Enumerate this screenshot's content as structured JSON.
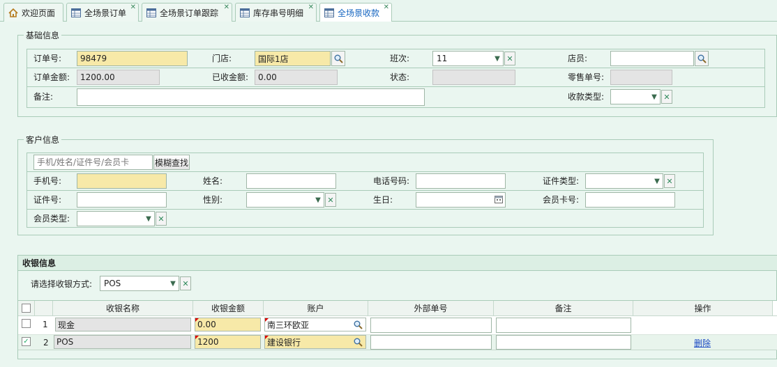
{
  "tabs": [
    {
      "label": "欢迎页面",
      "icon": "home-icon",
      "closable": false,
      "active": false
    },
    {
      "label": "全场景订单",
      "icon": "table-icon",
      "closable": true,
      "active": false
    },
    {
      "label": "全场景订单跟踪",
      "icon": "table-icon",
      "closable": true,
      "active": false
    },
    {
      "label": "库存串号明细",
      "icon": "table-icon",
      "closable": true,
      "active": false
    },
    {
      "label": "全场景收款",
      "icon": "table-icon",
      "closable": true,
      "active": true
    }
  ],
  "basic": {
    "legend": "基础信息",
    "order_no_label": "订单号:",
    "order_no": "98479",
    "store_label": "门店:",
    "store": "国际1店",
    "shift_label": "班次:",
    "shift": "11",
    "clerk_label": "店员:",
    "clerk": "",
    "amount_label": "订单金额:",
    "amount": "1200.00",
    "received_label": "已收金额:",
    "received": "0.00",
    "status_label": "状态:",
    "status": "",
    "retail_no_label": "零售单号:",
    "retail_no": "",
    "remark_label": "备注:",
    "remark": "",
    "pay_type_label": "收款类型:",
    "pay_type": ""
  },
  "customer": {
    "legend": "客户信息",
    "search_placeholder": "手机/姓名/证件号/会员卡",
    "fuzzy_btn": "模糊查找",
    "phone_label": "手机号:",
    "name_label": "姓名:",
    "tel_label": "电话号码:",
    "id_type_label": "证件类型:",
    "id_no_label": "证件号:",
    "gender_label": "性别:",
    "birthday_label": "生日:",
    "member_card_label": "会员卡号:",
    "member_type_label": "会员类型:"
  },
  "cashier": {
    "title": "收银信息",
    "method_label": "请选择收银方式:",
    "method": "POS",
    "columns": [
      "收银名称",
      "收银金额",
      "账户",
      "外部单号",
      "备注",
      "操作"
    ],
    "rows": [
      {
        "no": "1",
        "name": "现金",
        "amount": "0.00",
        "account": "南三环欧亚",
        "ext_no": "",
        "remark": "",
        "action": "",
        "checked": false
      },
      {
        "no": "2",
        "name": "POS",
        "amount": "1200",
        "account": "建设银行",
        "ext_no": "",
        "remark": "",
        "action": "删除",
        "checked": true
      }
    ]
  },
  "colors": {
    "accent": "#1565c0",
    "required_bg": "#f7e9a8",
    "readonly_bg": "#e4e4e4",
    "panel_bg": "#eaf6f0"
  }
}
